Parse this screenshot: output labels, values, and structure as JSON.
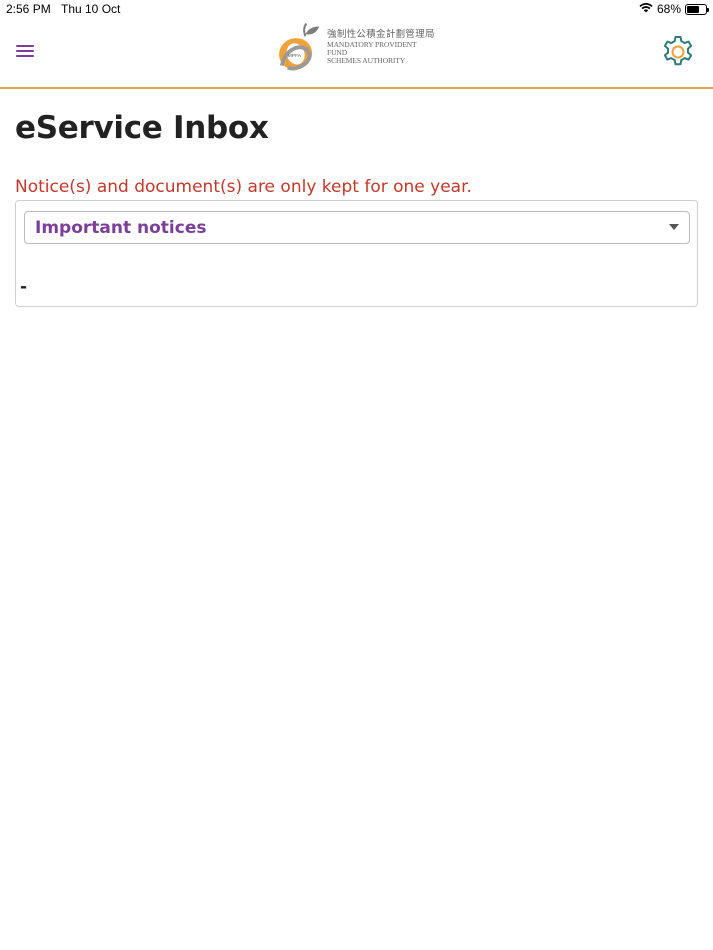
{
  "status_bar": {
    "time": "2:56 PM",
    "date": "Thu 10 Oct",
    "battery": "68%",
    "battery_level": 0.68,
    "wifi_icon": "wifi-icon",
    "battery_icon": "battery-icon"
  },
  "header": {
    "menu_icon": "hamburger-menu-icon",
    "logo": {
      "chinese": "強制性公積金計劃管理局",
      "english_line1": "MANDATORY PROVIDENT FUND",
      "english_line2": "SCHEMES AUTHORITY",
      "emblem_text": "MPFA"
    },
    "settings_icon": "gear-icon",
    "accent_color": "#e8a44a",
    "brand_color": "#7b3f98"
  },
  "page": {
    "title": "eService Inbox",
    "notice": "Notice(s) and document(s) are only kept for one year.",
    "notice_color": "#c0392b"
  },
  "filter": {
    "selected": "Important notices",
    "arrow_icon": "caret-down-icon"
  },
  "content": {
    "empty_value": "-"
  }
}
